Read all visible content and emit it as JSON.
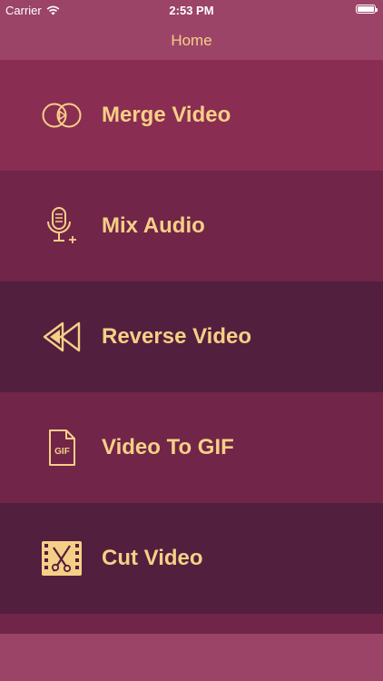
{
  "status_bar": {
    "carrier": "Carrier",
    "time": "2:53 PM"
  },
  "nav": {
    "title": "Home"
  },
  "menu": {
    "items": [
      {
        "label": "Merge Video",
        "icon": "merge-video-icon",
        "bg": "#8a2d52"
      },
      {
        "label": "Mix Audio",
        "icon": "mix-audio-icon",
        "bg": "#712548"
      },
      {
        "label": "Reverse Video",
        "icon": "reverse-video-icon",
        "bg": "#531f3e"
      },
      {
        "label": "Video To GIF",
        "icon": "video-to-gif-icon",
        "bg": "#712548"
      },
      {
        "label": "Cut Video",
        "icon": "cut-video-icon",
        "bg": "#531f3e"
      }
    ],
    "partial_row_bg": "#712548"
  },
  "colors": {
    "accent": "#f6cf86",
    "background": "#9b4468"
  },
  "gif_icon_text": "GIF"
}
